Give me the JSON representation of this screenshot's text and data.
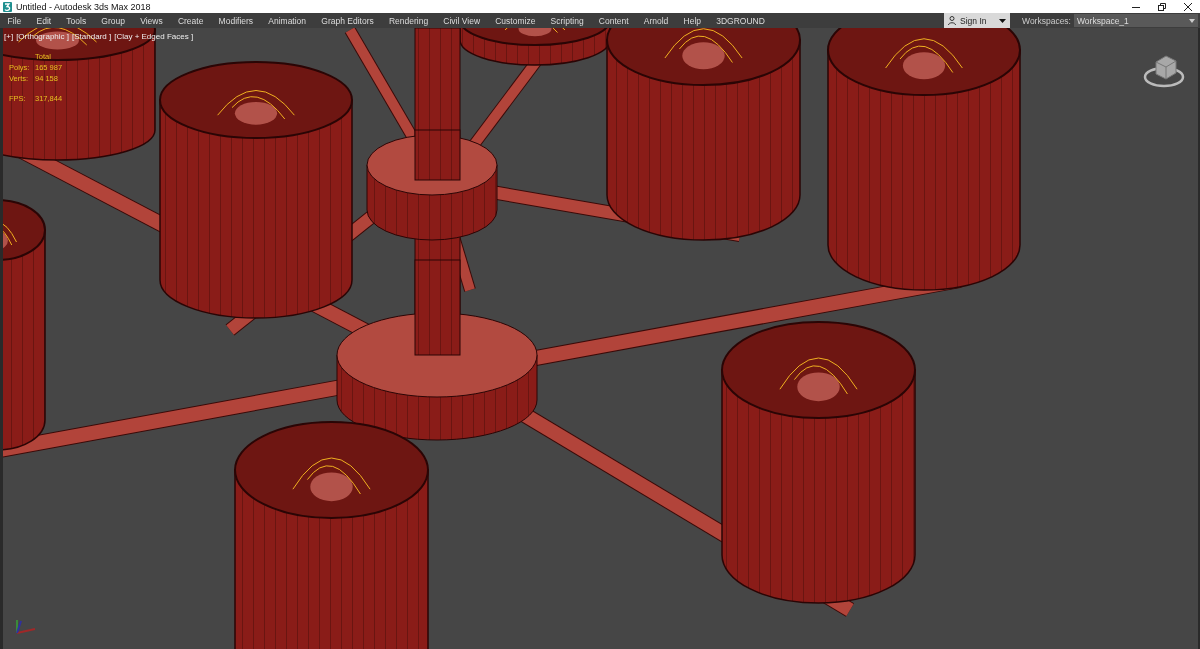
{
  "window": {
    "title": "Untitled - Autodesk 3ds Max 2018"
  },
  "menu_bar": {
    "items": [
      "File",
      "Edit",
      "Tools",
      "Group",
      "Views",
      "Create",
      "Modifiers",
      "Animation",
      "Graph Editors",
      "Rendering",
      "Civil View",
      "Customize",
      "Scripting",
      "Content",
      "Arnold",
      "Help",
      "3DGROUND"
    ]
  },
  "account": {
    "label": "Sign In"
  },
  "workspaces": {
    "label": "Workspaces:",
    "value": "Workspace_1"
  },
  "viewport": {
    "labels": [
      "[+]",
      "[Orthographic ]",
      "[Standard ]",
      "[Clay + Edged Faces ]"
    ],
    "stats": {
      "heading": "Total",
      "rows": [
        {
          "kind": "count",
          "label": "Polys:",
          "value": "165 987"
        },
        {
          "kind": "count",
          "label": "Verts:",
          "value": "94 158"
        },
        {
          "kind": "rate",
          "label": "FPS:",
          "value": "317,844"
        }
      ]
    }
  }
}
